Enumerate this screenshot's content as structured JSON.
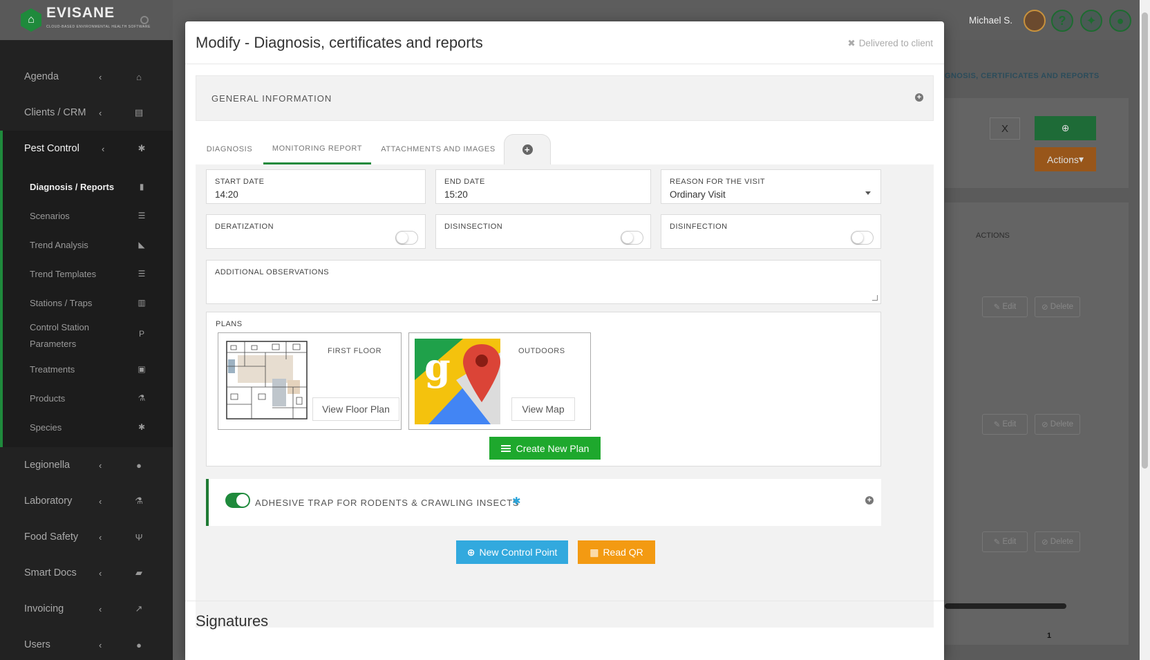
{
  "brand": {
    "name": "EVISANE",
    "tagline": "CLOUD-BASED ENVIRONMENTAL HEALTH SOFTWARE",
    "color": "#1f8a3c"
  },
  "sidebar": {
    "items": [
      {
        "label": "Agenda",
        "icon": "home-icon"
      },
      {
        "label": "Clients / CRM",
        "icon": "id-card-icon"
      },
      {
        "label": "Pest Control",
        "icon": "bug-icon",
        "active": true
      }
    ],
    "pest_sub": [
      {
        "label": "Diagnosis / Reports",
        "icon": "clipboard-icon",
        "active": true
      },
      {
        "label": "Scenarios",
        "icon": "list-icon"
      },
      {
        "label": "Trend Analysis",
        "icon": "area-chart-icon"
      },
      {
        "label": "Trend Templates",
        "icon": "list-icon"
      },
      {
        "label": "Stations / Traps",
        "icon": "archive-icon"
      },
      {
        "label": "Control Station Parameters",
        "icon": "parking-icon"
      },
      {
        "label": "Treatments",
        "icon": "medkit-icon"
      },
      {
        "label": "Products",
        "icon": "flask-icon"
      },
      {
        "label": "Species",
        "icon": "bug-icon"
      }
    ],
    "bottom_items": [
      {
        "label": "Legionella",
        "icon": "drop-icon"
      },
      {
        "label": "Laboratory",
        "icon": "flask-icon"
      },
      {
        "label": "Food Safety",
        "icon": "cutlery-icon"
      },
      {
        "label": "Smart Docs",
        "icon": "folder-open-icon"
      },
      {
        "label": "Invoicing",
        "icon": "line-chart-icon"
      },
      {
        "label": "Users",
        "icon": "user-icon"
      }
    ]
  },
  "topbar": {
    "user_name": "Michael S.",
    "help_icon": "?",
    "gift_icon": "gift-icon",
    "chat_icon": "chat-icon"
  },
  "background": {
    "breadcrumb": "GNOSIS, CERTIFICATES AND REPORTS",
    "clear_label": "X",
    "actions_label": "Actions",
    "actions_column": "ACTIONS",
    "edit_label": "Edit",
    "delete_label": "Delete",
    "page_number": "1"
  },
  "modal": {
    "title": "Modify - Diagnosis, certificates and reports",
    "delivered_label": "Delivered to client",
    "general_info_title": "GENERAL INFORMATION",
    "tabs": [
      {
        "label": "DIAGNOSIS"
      },
      {
        "label": "MONITORING REPORT",
        "active": true
      },
      {
        "label": "ATTACHMENTS AND IMAGES"
      }
    ],
    "start_date": {
      "label": "START DATE",
      "value": "14:20"
    },
    "end_date": {
      "label": "END DATE",
      "value": "15:20"
    },
    "reason": {
      "label": "REASON FOR THE VISIT",
      "value": "Ordinary Visit"
    },
    "toggles": [
      {
        "label": "DERATIZATION",
        "on": false
      },
      {
        "label": "DISINSECTION",
        "on": false
      },
      {
        "label": "DISINFECTION",
        "on": false
      }
    ],
    "observations": {
      "label": "ADDITIONAL OBSERVATIONS",
      "value": ""
    },
    "plans": {
      "label": "PLANS",
      "items": [
        {
          "name": "FIRST FLOOR",
          "button": "View Floor Plan",
          "thumb": "floor-plan"
        },
        {
          "name": "OUTDOORS",
          "button": "View Map",
          "thumb": "google-maps"
        }
      ],
      "create_label": "Create New Plan"
    },
    "trap": {
      "title": "ADHESIVE TRAP FOR RODENTS & CRAWLING INSECTS",
      "enabled": true
    },
    "new_control_point_label": "New Control Point",
    "read_qr_label": "Read QR",
    "signatures_title": "Signatures"
  }
}
